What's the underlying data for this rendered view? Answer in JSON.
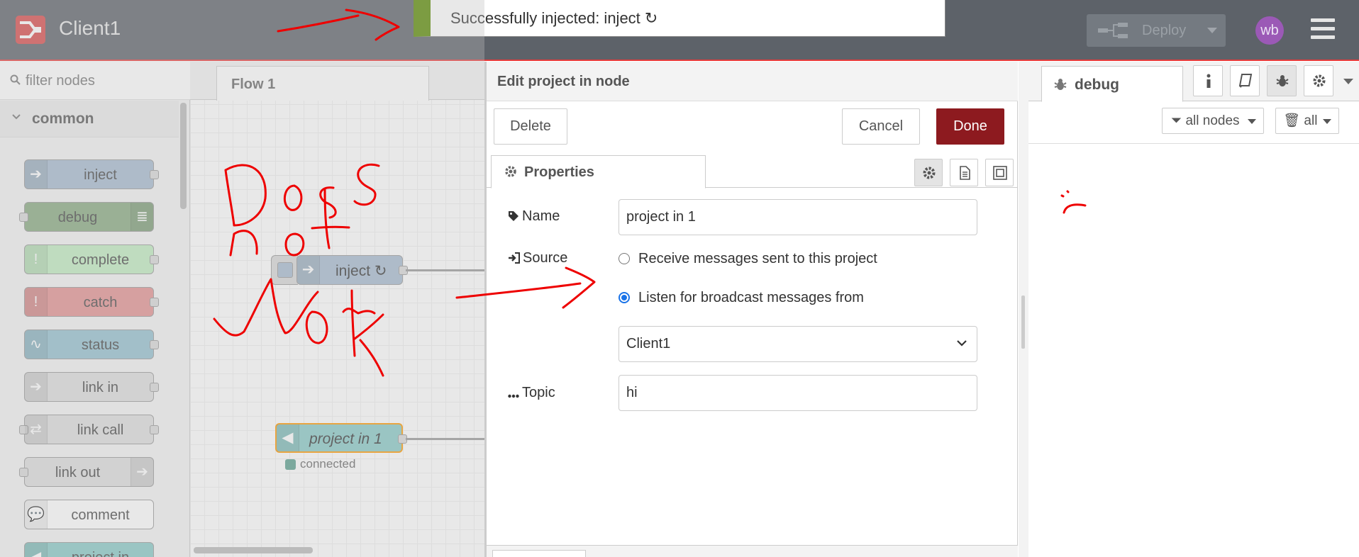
{
  "header": {
    "app_title": "Client1",
    "deploy_label": "Deploy",
    "avatar_initials": "wb",
    "icons": {
      "logo": "node-red-logo-icon",
      "deploy": "deploy-flow-icon",
      "menu": "hamburger-menu-icon"
    }
  },
  "notification": {
    "message": "Successfully injected: inject ↻",
    "accent_color": "#5a8a00"
  },
  "palette": {
    "filter_placeholder": "filter nodes",
    "category": "common",
    "nodes": [
      {
        "label": "inject",
        "color": "#a6bbcf"
      },
      {
        "label": "debug",
        "color": "#87a980"
      },
      {
        "label": "complete",
        "color": "#c0edc0"
      },
      {
        "label": "catch",
        "color": "#e49191"
      },
      {
        "label": "status",
        "color": "#94c1d0"
      },
      {
        "label": "link in",
        "color": "#dddddd"
      },
      {
        "label": "link call",
        "color": "#dddddd"
      },
      {
        "label": "link out",
        "color": "#dddddd"
      },
      {
        "label": "comment",
        "color": "#ffffff"
      },
      {
        "label": "project in",
        "color": "#87c9c6"
      }
    ]
  },
  "workspace": {
    "tab_label": "Flow 1",
    "inject_node_label": "inject ↻",
    "project_node_label": "project in 1",
    "project_node_status": "connected"
  },
  "tray": {
    "title": "Edit project in node",
    "delete_label": "Delete",
    "cancel_label": "Cancel",
    "done_label": "Done",
    "properties_tab": "Properties",
    "name_label": "Name",
    "name_value": "project in 1",
    "source_label": "Source",
    "source_option_1": "Receive messages sent to this project",
    "source_option_2": "Listen for broadcast messages from",
    "source_selected": 2,
    "project_select_value": "Client1",
    "topic_label": "Topic",
    "topic_value": "hi",
    "done_color": "#8d1a1f"
  },
  "sidebar": {
    "tab_label": "debug",
    "filter_label": "all nodes",
    "clear_label": "all",
    "icons": [
      "info-icon",
      "book-icon",
      "bug-icon",
      "gear-icon"
    ]
  },
  "annotation": {
    "handwritten_text": "Does not work",
    "color": "#e00000"
  }
}
